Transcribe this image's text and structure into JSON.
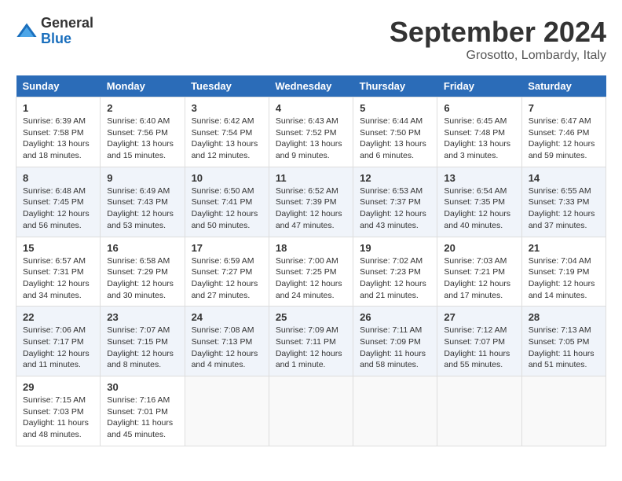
{
  "header": {
    "logo_general": "General",
    "logo_blue": "Blue",
    "month_title": "September 2024",
    "location": "Grosotto, Lombardy, Italy"
  },
  "days_of_week": [
    "Sunday",
    "Monday",
    "Tuesday",
    "Wednesday",
    "Thursday",
    "Friday",
    "Saturday"
  ],
  "weeks": [
    [
      {
        "day": "1",
        "sunrise": "6:39 AM",
        "sunset": "7:58 PM",
        "daylight": "13 hours and 18 minutes."
      },
      {
        "day": "2",
        "sunrise": "6:40 AM",
        "sunset": "7:56 PM",
        "daylight": "13 hours and 15 minutes."
      },
      {
        "day": "3",
        "sunrise": "6:42 AM",
        "sunset": "7:54 PM",
        "daylight": "13 hours and 12 minutes."
      },
      {
        "day": "4",
        "sunrise": "6:43 AM",
        "sunset": "7:52 PM",
        "daylight": "13 hours and 9 minutes."
      },
      {
        "day": "5",
        "sunrise": "6:44 AM",
        "sunset": "7:50 PM",
        "daylight": "13 hours and 6 minutes."
      },
      {
        "day": "6",
        "sunrise": "6:45 AM",
        "sunset": "7:48 PM",
        "daylight": "13 hours and 3 minutes."
      },
      {
        "day": "7",
        "sunrise": "6:47 AM",
        "sunset": "7:46 PM",
        "daylight": "12 hours and 59 minutes."
      }
    ],
    [
      {
        "day": "8",
        "sunrise": "6:48 AM",
        "sunset": "7:45 PM",
        "daylight": "12 hours and 56 minutes."
      },
      {
        "day": "9",
        "sunrise": "6:49 AM",
        "sunset": "7:43 PM",
        "daylight": "12 hours and 53 minutes."
      },
      {
        "day": "10",
        "sunrise": "6:50 AM",
        "sunset": "7:41 PM",
        "daylight": "12 hours and 50 minutes."
      },
      {
        "day": "11",
        "sunrise": "6:52 AM",
        "sunset": "7:39 PM",
        "daylight": "12 hours and 47 minutes."
      },
      {
        "day": "12",
        "sunrise": "6:53 AM",
        "sunset": "7:37 PM",
        "daylight": "12 hours and 43 minutes."
      },
      {
        "day": "13",
        "sunrise": "6:54 AM",
        "sunset": "7:35 PM",
        "daylight": "12 hours and 40 minutes."
      },
      {
        "day": "14",
        "sunrise": "6:55 AM",
        "sunset": "7:33 PM",
        "daylight": "12 hours and 37 minutes."
      }
    ],
    [
      {
        "day": "15",
        "sunrise": "6:57 AM",
        "sunset": "7:31 PM",
        "daylight": "12 hours and 34 minutes."
      },
      {
        "day": "16",
        "sunrise": "6:58 AM",
        "sunset": "7:29 PM",
        "daylight": "12 hours and 30 minutes."
      },
      {
        "day": "17",
        "sunrise": "6:59 AM",
        "sunset": "7:27 PM",
        "daylight": "12 hours and 27 minutes."
      },
      {
        "day": "18",
        "sunrise": "7:00 AM",
        "sunset": "7:25 PM",
        "daylight": "12 hours and 24 minutes."
      },
      {
        "day": "19",
        "sunrise": "7:02 AM",
        "sunset": "7:23 PM",
        "daylight": "12 hours and 21 minutes."
      },
      {
        "day": "20",
        "sunrise": "7:03 AM",
        "sunset": "7:21 PM",
        "daylight": "12 hours and 17 minutes."
      },
      {
        "day": "21",
        "sunrise": "7:04 AM",
        "sunset": "7:19 PM",
        "daylight": "12 hours and 14 minutes."
      }
    ],
    [
      {
        "day": "22",
        "sunrise": "7:06 AM",
        "sunset": "7:17 PM",
        "daylight": "12 hours and 11 minutes."
      },
      {
        "day": "23",
        "sunrise": "7:07 AM",
        "sunset": "7:15 PM",
        "daylight": "12 hours and 8 minutes."
      },
      {
        "day": "24",
        "sunrise": "7:08 AM",
        "sunset": "7:13 PM",
        "daylight": "12 hours and 4 minutes."
      },
      {
        "day": "25",
        "sunrise": "7:09 AM",
        "sunset": "7:11 PM",
        "daylight": "12 hours and 1 minute."
      },
      {
        "day": "26",
        "sunrise": "7:11 AM",
        "sunset": "7:09 PM",
        "daylight": "11 hours and 58 minutes."
      },
      {
        "day": "27",
        "sunrise": "7:12 AM",
        "sunset": "7:07 PM",
        "daylight": "11 hours and 55 minutes."
      },
      {
        "day": "28",
        "sunrise": "7:13 AM",
        "sunset": "7:05 PM",
        "daylight": "11 hours and 51 minutes."
      }
    ],
    [
      {
        "day": "29",
        "sunrise": "7:15 AM",
        "sunset": "7:03 PM",
        "daylight": "11 hours and 48 minutes."
      },
      {
        "day": "30",
        "sunrise": "7:16 AM",
        "sunset": "7:01 PM",
        "daylight": "11 hours and 45 minutes."
      },
      {
        "day": "",
        "sunrise": "",
        "sunset": "",
        "daylight": ""
      },
      {
        "day": "",
        "sunrise": "",
        "sunset": "",
        "daylight": ""
      },
      {
        "day": "",
        "sunrise": "",
        "sunset": "",
        "daylight": ""
      },
      {
        "day": "",
        "sunrise": "",
        "sunset": "",
        "daylight": ""
      },
      {
        "day": "",
        "sunrise": "",
        "sunset": "",
        "daylight": ""
      }
    ]
  ],
  "labels": {
    "sunrise": "Sunrise:",
    "sunset": "Sunset:",
    "daylight": "Daylight:"
  }
}
